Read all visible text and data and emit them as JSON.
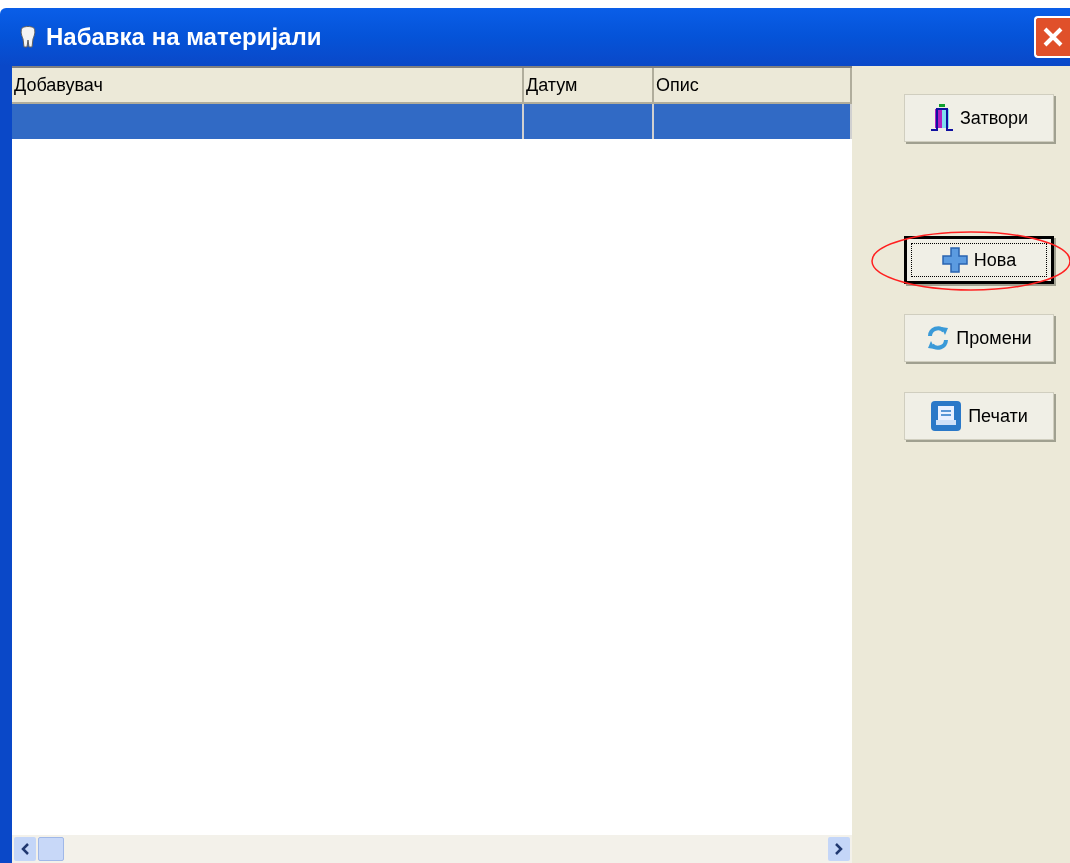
{
  "window": {
    "title": "Набавка на материјали"
  },
  "table": {
    "columns": [
      "Добавувач",
      "Датум",
      "Опис"
    ],
    "rows": [
      {
        "selected": true
      }
    ]
  },
  "buttons": [
    {
      "label": "Затвори",
      "kind": "close",
      "focused": false,
      "circled": false
    },
    {
      "label": "Нова",
      "kind": "new",
      "focused": true,
      "circled": true
    },
    {
      "label": "Промени",
      "kind": "edit",
      "focused": false,
      "circled": false
    },
    {
      "label": "Печати",
      "kind": "print",
      "focused": false,
      "circled": false
    }
  ]
}
